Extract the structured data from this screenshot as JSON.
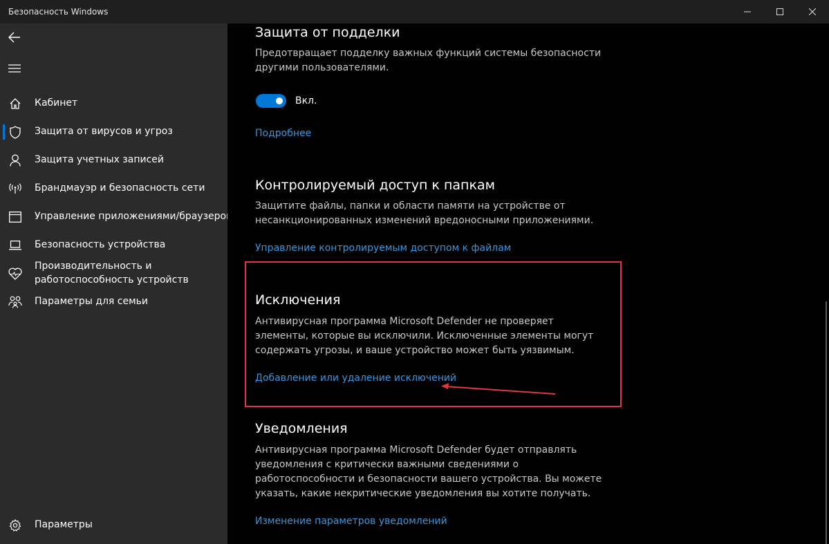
{
  "window": {
    "title": "Безопасность Windows",
    "controls": [
      "minimize",
      "maximize",
      "close"
    ]
  },
  "sidebar": {
    "back_icon": "back-arrow-icon",
    "menu_icon": "hamburger-icon",
    "items": [
      {
        "label": "Кабинет",
        "icon": "home-icon"
      },
      {
        "label": "Защита от вирусов и угроз",
        "icon": "shield-icon",
        "active": true
      },
      {
        "label": "Защита учетных записей",
        "icon": "person-icon"
      },
      {
        "label": "Брандмауэр и безопасность сети",
        "icon": "wireless-icon"
      },
      {
        "label": "Управление приложениями/браузером",
        "icon": "app-window-icon"
      },
      {
        "label": "Безопасность устройства",
        "icon": "laptop-icon"
      },
      {
        "label_line1": "Производительность и",
        "label_line2": "работоспособность устройств",
        "icon": "heart-icon"
      },
      {
        "label": "Параметры для семьи",
        "icon": "family-icon"
      }
    ],
    "settings": {
      "label": "Параметры",
      "icon": "gear-icon"
    }
  },
  "main": {
    "tamper": {
      "title": "Защита от подделки",
      "desc_line1": "Предотвращает подделку важных функций системы безопасности",
      "desc_line2": "другими пользователями.",
      "toggle_state": "Вкл.",
      "toggle_on": true,
      "link": "Подробнее"
    },
    "folder_access": {
      "title": "Контролируемый доступ к папкам",
      "desc_line1": "Защитите файлы, папки и области памяти на устройстве от",
      "desc_line2": "несанкционированных изменений вредоносными приложениями.",
      "link": "Управление контролируемым доступом к файлам"
    },
    "exclusions": {
      "title": "Исключения",
      "desc_line1": "Антивирусная программа Microsoft Defender не проверяет",
      "desc_line2": "элементы, которые вы исключили. Исключенные элементы могут",
      "desc_line3": "содержать угрозы, и ваше устройство может быть уязвимым.",
      "link": "Добавление или удаление исключений"
    },
    "notifications": {
      "title": "Уведомления",
      "desc_line1": "Антивирусная программа Microsoft Defender будет отправлять",
      "desc_line2": "уведомления с критически важными сведениями о",
      "desc_line3": "работоспособности и безопасности вашего устройства. Вы можете",
      "desc_line4": "указать, какие некритические уведомления вы хотите получать.",
      "link": "Изменение параметров уведомлений"
    }
  },
  "colors": {
    "accent": "#0078d7",
    "link": "#3a96dd",
    "highlight": "#e0383e",
    "sidebar_bg": "#2b2b2b",
    "main_bg": "#000000"
  }
}
